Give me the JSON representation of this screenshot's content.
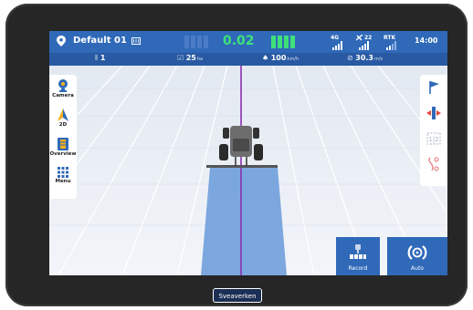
{
  "topbar": {
    "field_name": "Default 01",
    "lightbar_value": "0.02",
    "signals": [
      {
        "label": "4G",
        "icon": "cellular-signal-icon"
      },
      {
        "label": "22",
        "icon": "satellite-icon"
      },
      {
        "label": "RTK",
        "icon": "rtk-signal-icon"
      }
    ],
    "time": "14:00"
  },
  "infobar": {
    "pass_number": "1",
    "area": {
      "value": "25",
      "unit": "ha"
    },
    "speed": {
      "value": "100",
      "unit": "km/h"
    },
    "width": {
      "value": "30.3",
      "unit": "m/s"
    }
  },
  "left_panel": [
    {
      "label": "Camera",
      "icon": "camera-icon"
    },
    {
      "label": "2D",
      "icon": "navigation-arrow-icon"
    },
    {
      "label": "Overview",
      "icon": "overview-icon"
    },
    {
      "label": "Menu",
      "icon": "grid-menu-icon"
    }
  ],
  "right_panel": [
    "flag-icon",
    "shift-line-icon",
    "ab-line-icon",
    "curve-line-icon"
  ],
  "bottom_buttons": {
    "record": {
      "label": "Record",
      "icon": "implement-record-icon"
    },
    "auto": {
      "label": "Auto",
      "icon": "steering-wheel-icon"
    }
  },
  "brand": "Sveaverken",
  "colors": {
    "topbar": "#2f69b8",
    "infobar": "#2859a2",
    "lightbar_green": "#3fe07a",
    "coverage": "#6f9fdc",
    "guidance_line": "#8a2fb0"
  }
}
